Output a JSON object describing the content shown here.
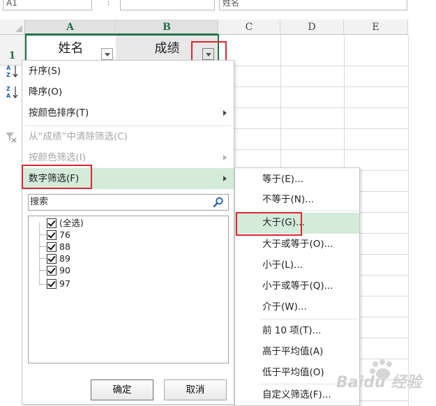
{
  "formula_bar": {
    "name_box_value": "A1",
    "formula_value": "姓名"
  },
  "columns": [
    "A",
    "B",
    "C",
    "D",
    "E"
  ],
  "rows": [
    "1"
  ],
  "cells": {
    "A1": "姓名",
    "B1": "成绩"
  },
  "filter_menu": {
    "sort_asc": "升序(S)",
    "sort_desc": "降序(O)",
    "sort_by_color": "按颜色排序(T)",
    "clear_filter": "从“成绩”中清除筛选(C)",
    "filter_by_color": "按颜色筛选(I)",
    "number_filter": "数字筛选(F)",
    "search_placeholder": "搜索",
    "list_items": [
      "(全选)",
      "76",
      "88",
      "89",
      "90",
      "97"
    ],
    "ok_label": "确定",
    "cancel_label": "取消"
  },
  "number_filter_submenu": {
    "items": [
      "等于(E)...",
      "不等于(N)...",
      "大于(G)...",
      "大于或等于(O)...",
      "小于(L)...",
      "小于或等于(Q)...",
      "介于(W)...",
      "前 10 项(T)...",
      "高于平均值(A)",
      "低于平均值(O)",
      "自定义筛选(F)..."
    ],
    "highlighted": "大于(G)..."
  },
  "icons": [
    "sort-ascending-icon",
    "sort-descending-icon",
    "clear-filter-icon",
    "search-icon",
    "dropdown-arrow-icon"
  ],
  "colors": {
    "accent_green": "#217346",
    "highlight": "#d3ebd9",
    "annotation_red": "#e0262d"
  },
  "watermark": "Baidu 经验"
}
